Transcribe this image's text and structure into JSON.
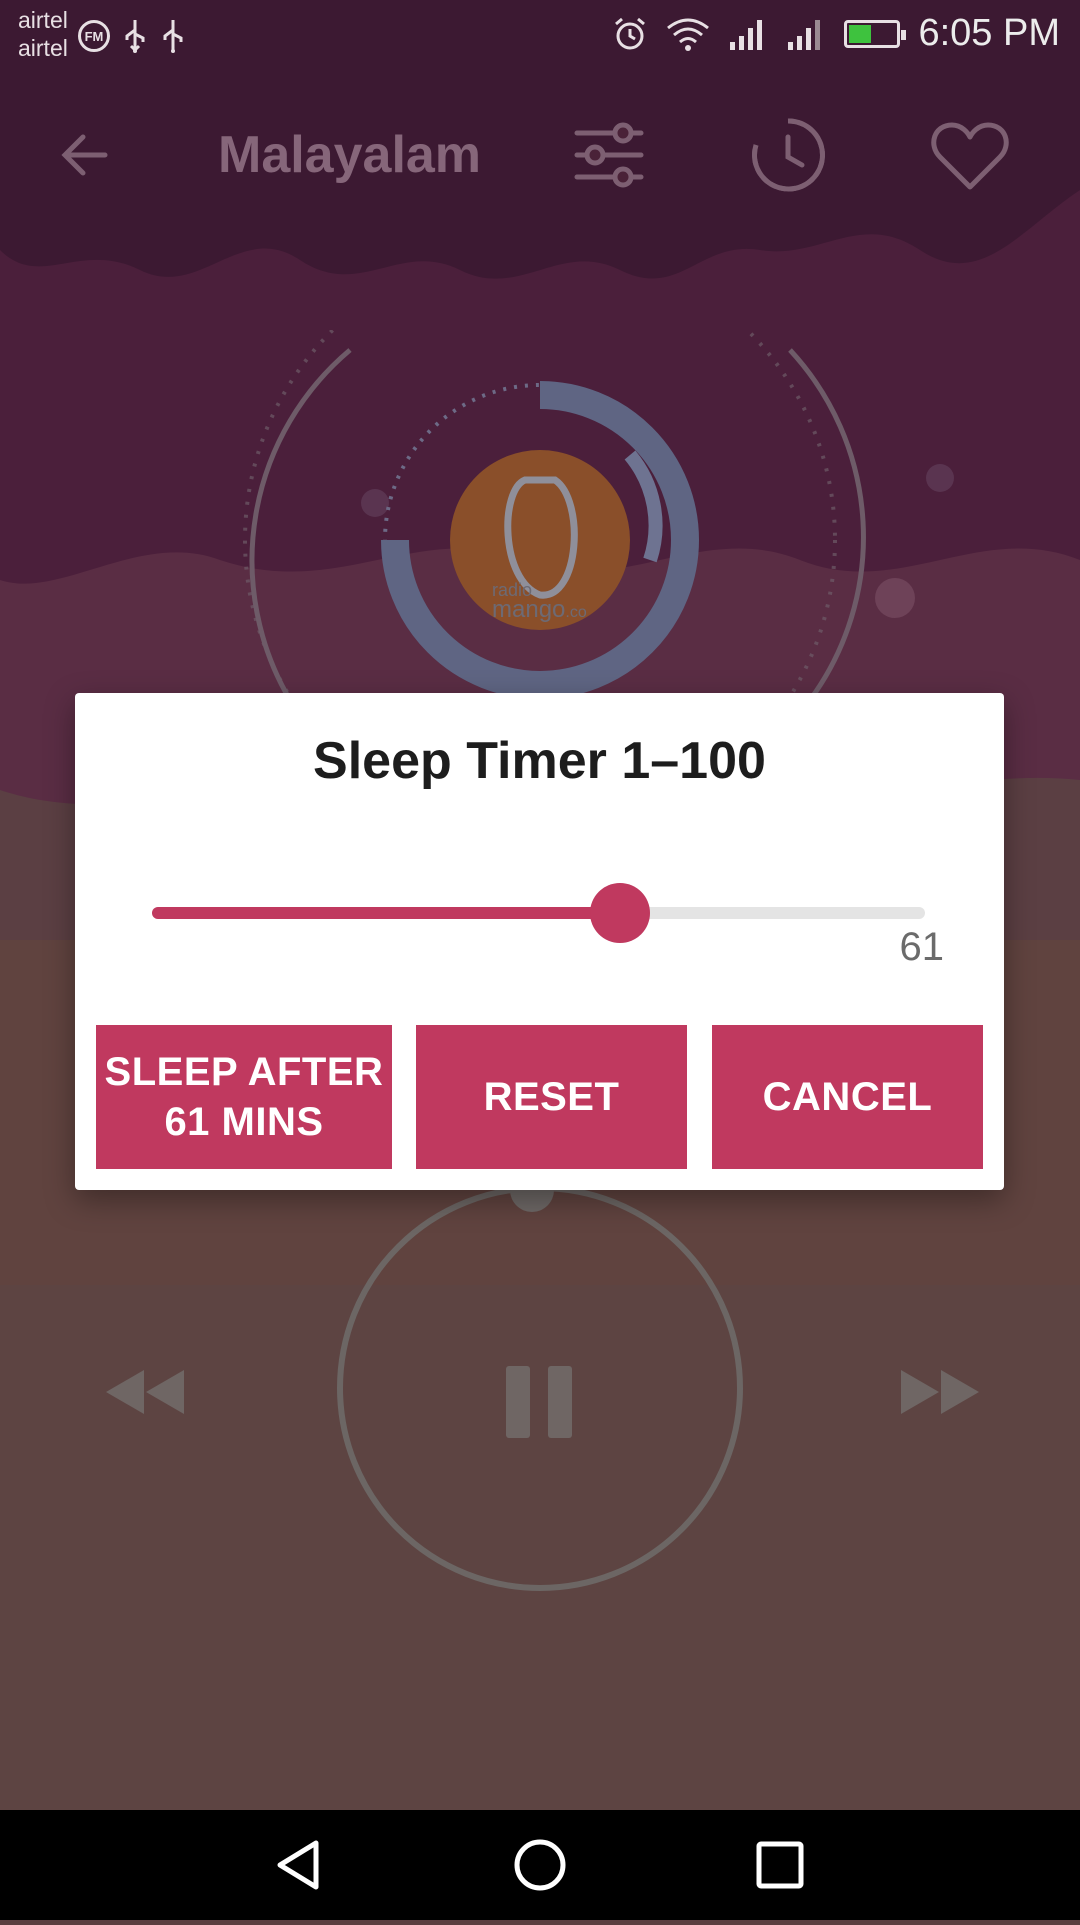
{
  "status_bar": {
    "carrier_1": "airtel",
    "carrier_2": "airtel",
    "fm_badge": "FM",
    "time": "6:05 PM",
    "icons": [
      "fm-radio-icon",
      "usb-icon",
      "usb-icon",
      "alarm-icon",
      "wifi-icon",
      "signal-icon",
      "signal-icon",
      "battery-charging-icon"
    ]
  },
  "app_bar": {
    "title": "Malayalam",
    "icons": [
      "back-arrow-icon",
      "equalizer-icon",
      "sleep-timer-icon",
      "heart-icon"
    ]
  },
  "player": {
    "station_logo_text_1": "radio",
    "station_logo_text_2": "mango",
    "station_logo_text_3": ".co",
    "icons": [
      "rewind-icon",
      "pause-icon",
      "fast-forward-icon"
    ]
  },
  "dialog": {
    "title": "Sleep Timer 1–100",
    "slider": {
      "min": 1,
      "max": 100,
      "value": 61
    },
    "value_text": "61",
    "buttons": {
      "sleep_line1": "SLEEP AFTER",
      "sleep_line2": "61 MINS",
      "reset": "RESET",
      "cancel": "CANCEL"
    }
  },
  "colors": {
    "accent": "#c0395f",
    "dialog_bg": "#ffffff",
    "top_bg": "#4a2238",
    "bottom_bg": "#5e4442"
  },
  "nav_bar": {
    "icons": [
      "nav-back-icon",
      "nav-home-icon",
      "nav-recents-icon"
    ]
  }
}
